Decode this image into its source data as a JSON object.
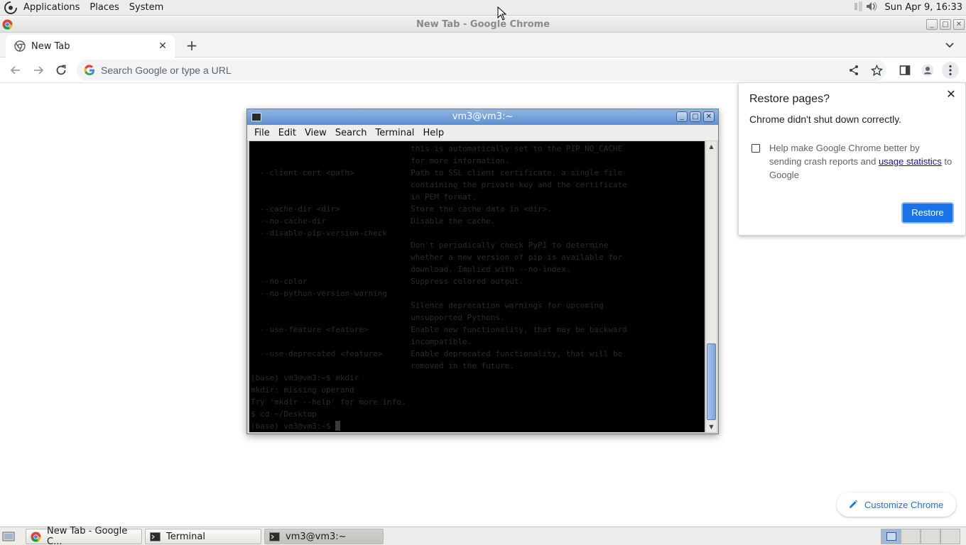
{
  "top_panel": {
    "menus": [
      "Applications",
      "Places",
      "System"
    ],
    "clock": "Sun Apr  9, 16:33"
  },
  "chrome": {
    "window_title": "New Tab - Google Chrome",
    "tab": {
      "title": "New Tab"
    },
    "omnibox": {
      "placeholder": "Search Google or type a URL"
    },
    "restore_bubble": {
      "title": "Restore pages?",
      "message": "Chrome didn't shut down correctly.",
      "checkbox_text_before": "Help make Google Chrome better by sending crash reports and ",
      "checkbox_link": "usage statistics",
      "checkbox_text_after": " to Google",
      "restore_label": "Restore"
    },
    "customize_label": "Customize Chrome",
    "accent": "#1a73e8"
  },
  "terminal": {
    "title": "vm3@vm3:~",
    "menus": [
      "File",
      "Edit",
      "View",
      "Search",
      "Terminal",
      "Help"
    ],
    "lines": [
      "                                  this is automatically set to the PIP_NO_CACHE",
      "                                  for more information.",
      "  --client-cert <path>            Path to SSL client certificate, a single file",
      "                                  containing the private key and the certificate",
      "                                  in PEM format.",
      "  --cache-dir <dir>               Store the cache data in <dir>.",
      "  --no-cache-dir                  Disable the cache.",
      "  --disable-pip-version-check",
      "                                  Don't periodically check PyPI to determine",
      "                                  whether a new version of pip is available for",
      "                                  download. Implied with --no-index.",
      "  --no-color                      Suppress colored output.",
      "  --no-python-version-warning",
      "                                  Silence deprecation warnings for upcoming",
      "                                  unsupported Pythons.",
      "  --use-feature <feature>         Enable new functionality, that may be backward",
      "                                  incompatible.",
      "  --use-deprecated <feature>      Enable deprecated functionality, that will be",
      "                                  removed in the future.",
      "(base) vm3@vm3:~$ mkdir",
      "mkdir: missing operand",
      "Try 'mkdir --help' for more info.",
      "$ cd ~/Desktop",
      "(base) vm3@vm3:~$ "
    ]
  },
  "taskbar": {
    "tasks": [
      "New Tab - Google C...",
      "Terminal",
      "vm3@vm3:~"
    ]
  }
}
